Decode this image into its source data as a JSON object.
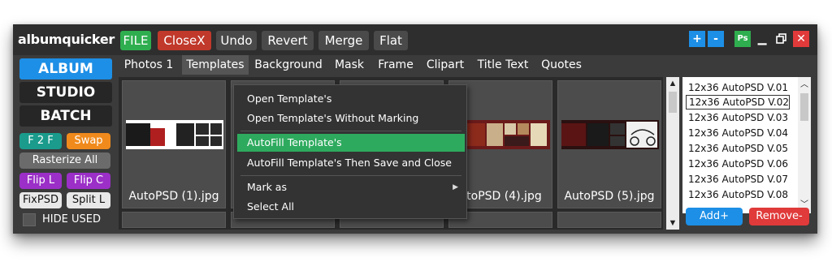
{
  "app": {
    "logo": "albumquicker"
  },
  "toolbar": {
    "file": "FILE",
    "closex": "CloseX",
    "undo": "Undo",
    "revert": "Revert",
    "merge": "Merge",
    "flat": "Flat",
    "plus": "+",
    "minus": "-",
    "ps": "Ps"
  },
  "colors": {
    "file": "#2fae4f",
    "closex": "#c0392b",
    "accent_blue": "#1d8fe6",
    "green": "#2eaa5e",
    "red": "#e03a3a"
  },
  "left": {
    "album": "ALBUM",
    "studio": "STUDIO",
    "batch": "BATCH",
    "f2f": "F 2 F",
    "swap": "Swap",
    "rasterize": "Rasterize All",
    "flipl": "Flip L",
    "flipc": "Flip C",
    "fixpsd": "FixPSD",
    "splitl": "Split L",
    "hide_used": "HIDE USED"
  },
  "tabs": [
    {
      "label": "Photos 1"
    },
    {
      "label": "Templates"
    },
    {
      "label": "Background"
    },
    {
      "label": "Mask"
    },
    {
      "label": "Frame"
    },
    {
      "label": "Clipart"
    },
    {
      "label": "Title Text"
    },
    {
      "label": "Quotes"
    }
  ],
  "thumbs": [
    {
      "caption": "AutoPSD (1).jpg"
    },
    {
      "caption": ""
    },
    {
      "caption": ""
    },
    {
      "caption": "utoPSD (4).jpg"
    },
    {
      "caption": "AutoPSD (5).jpg"
    }
  ],
  "context_menu": {
    "items": [
      "Open Template's",
      "Open Template's Without Marking",
      "AutoFill Template's",
      "AutoFill Template's Then Save and Close",
      "Mark as",
      "Select All"
    ]
  },
  "template_list": {
    "items": [
      "12x36 AutoPSD V.01",
      "12x36 AutoPSD V.02",
      "12x36 AutoPSD V.03",
      "12x36 AutoPSD V.04",
      "12x36 AutoPSD V.05",
      "12x36 AutoPSD V.06",
      "12x36 AutoPSD V.07",
      "12x36 AutoPSD V.08"
    ],
    "selected_index": 1,
    "add": "Add+",
    "remove": "Remove-"
  }
}
